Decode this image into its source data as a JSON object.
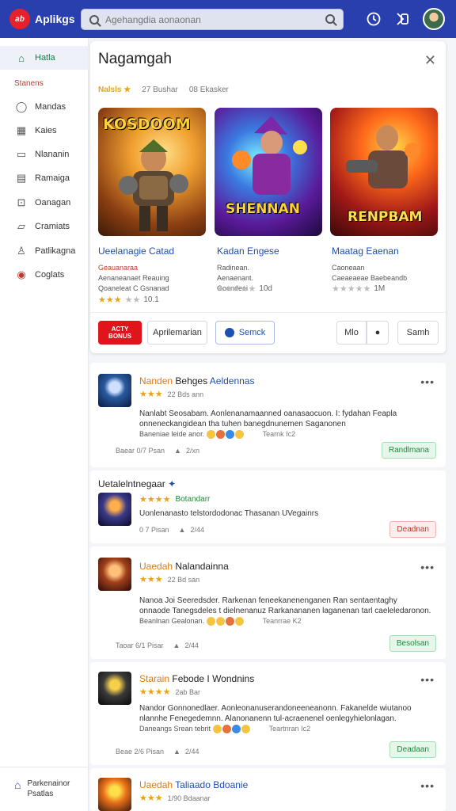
{
  "app": {
    "logo_badge": "ab",
    "name": "Aplikgs"
  },
  "search": {
    "placeholder": "Agehangdia aonaonan"
  },
  "topbar": {
    "icons": [
      "clock-icon",
      "share-icon"
    ]
  },
  "sidebar": {
    "section_label": "Stanens",
    "items": [
      {
        "label": "Hatla",
        "icon": "home-icon",
        "active": true
      },
      {
        "label": "Mandas",
        "icon": "pin-icon"
      },
      {
        "label": "Kaies",
        "icon": "table-icon"
      },
      {
        "label": "Nlananin",
        "icon": "bookmark-icon"
      },
      {
        "label": "Ramaiga",
        "icon": "document-icon"
      },
      {
        "label": "Oanagan",
        "icon": "lock-icon"
      },
      {
        "label": "Cramiats",
        "icon": "folder-icon"
      },
      {
        "label": "Patlikagna",
        "icon": "person-icon"
      },
      {
        "label": "Coglats",
        "icon": "target-icon"
      }
    ],
    "footer": {
      "line1": "Parkenainor",
      "line2": "Psatlas"
    }
  },
  "panel": {
    "title": "Nagamgah",
    "meta_rating": "Nalsls ★",
    "meta_reviews": "27 Bushar",
    "meta_extra": "08 Ekasker",
    "games": [
      {
        "art_title": "KOSDOOM",
        "name": "Ueelanagie Catad",
        "sub1": "Geauanaraa",
        "sub2": "Aenaneanaet Reauing",
        "sub3": "Qoaneleat C Gsnanad",
        "stars": "★★★",
        "gray_stars": "★★",
        "rating": "10.1",
        "palette": "orange"
      },
      {
        "art_title": "SHENNAN",
        "name": "Kadan Engese",
        "sub1": "Radinean.",
        "sub2": "Aenaenant.",
        "sub3": "Goendeai",
        "stars": "",
        "gray_stars": "★★★★★",
        "rating": "10d",
        "palette": "purple"
      },
      {
        "art_title": "RENPBAM",
        "name": "Maatag Eaenan",
        "sub1": "Caoneaan",
        "sub2": "Caeaeaeae Baebeandb",
        "sub3": "",
        "stars": "",
        "gray_stars": "★★★★★",
        "rating": "1M",
        "palette": "red"
      }
    ],
    "actions": {
      "red_line1": "ACTY",
      "red_line2": "BONUS",
      "secondary": "Aprilemarian",
      "blue": "Semck",
      "right1": "Mlo",
      "right2": "Samh"
    }
  },
  "reviews": [
    {
      "title_a": "Nanden",
      "title_b": "Behges",
      "title_c": "Aeldennas",
      "stars": "★★★",
      "date": "22 Bds ann",
      "body1": "Nanlabt Seosabam. Aonlenanamaanned oanasaocuon. I: fydahan Feapla",
      "body2": "onneneckangidean  tha tuhen banegdnunemen Saganonen",
      "body3": "Baneniae leide anor.",
      "extra": "Tearnk Ic2",
      "foot_a": "Baear 0/7 Psan",
      "foot_b": "2/xn",
      "tag": "Randlmana",
      "tag_color": "green",
      "thumb": "blue"
    },
    {
      "title_a": "Uetalelntnegaar",
      "title_b": "",
      "title_c": "",
      "stars": "★★★★",
      "date": "Botandarr",
      "body1": "Uonlenanasto telstordodonac Thasanan UVegainrs",
      "body2": "",
      "body3": "",
      "extra": "",
      "foot_a": "0 7 Pisan",
      "foot_b": "2/44",
      "tag": "Deadnan",
      "tag_color": "red",
      "thumb": "dark"
    },
    {
      "title_a": "Uaedah",
      "title_b": "Nalandainna",
      "title_c": "",
      "stars": "★★★",
      "date": "22 Bd san",
      "body1": "Nanoa Joi Seeredsder. Rarkenan feneekanenenganen Ran sentaentaghy",
      "body2": "onnaode Tanegsdeles t dielnenanuz Rarkanananen laganenan tarl caeleledaronon.",
      "body3": "Beanlnan Gealonan.",
      "extra": "Teanrrae K2",
      "foot_a": "Taoar 6/1 Pisar",
      "foot_b": "2/44",
      "tag": "Besolsan",
      "tag_color": "green",
      "thumb": "warm"
    },
    {
      "title_a": "Starain",
      "title_b": "Febode I Wondnins",
      "title_c": "",
      "stars": "★★★★",
      "date": "2ab Bar",
      "body1": "Nandor Gonnonedlaer. Aonleonanuserandoneeneanonn. Fakanelde wiutanoo",
      "body2": "nlannhe Fenegedemnn. Alanonanenn tul-acraenenel oenlegyhielonlagan.",
      "body3": "Daneangs Srean tebrit",
      "extra": "Teartnran Ic2",
      "foot_a": "Beae 2/6 Pisan",
      "foot_b": "2/44",
      "tag": "Deadaan",
      "tag_color": "green",
      "thumb": "yellow"
    },
    {
      "title_a": "Uaedah",
      "title_b": "Taliaado",
      "title_c": "Bdoanie",
      "stars": "★★★",
      "date": "1/90 Bdaanar",
      "body1": "",
      "body2": "",
      "body3": "",
      "extra": "",
      "foot_a": "",
      "foot_b": "",
      "tag": "",
      "tag_color": "",
      "thumb": "orange"
    }
  ],
  "colors": {
    "topbar": "#2a3fae",
    "accent_red": "#e0141b",
    "link_blue": "#1e4fb0",
    "star": "#e8a317"
  }
}
